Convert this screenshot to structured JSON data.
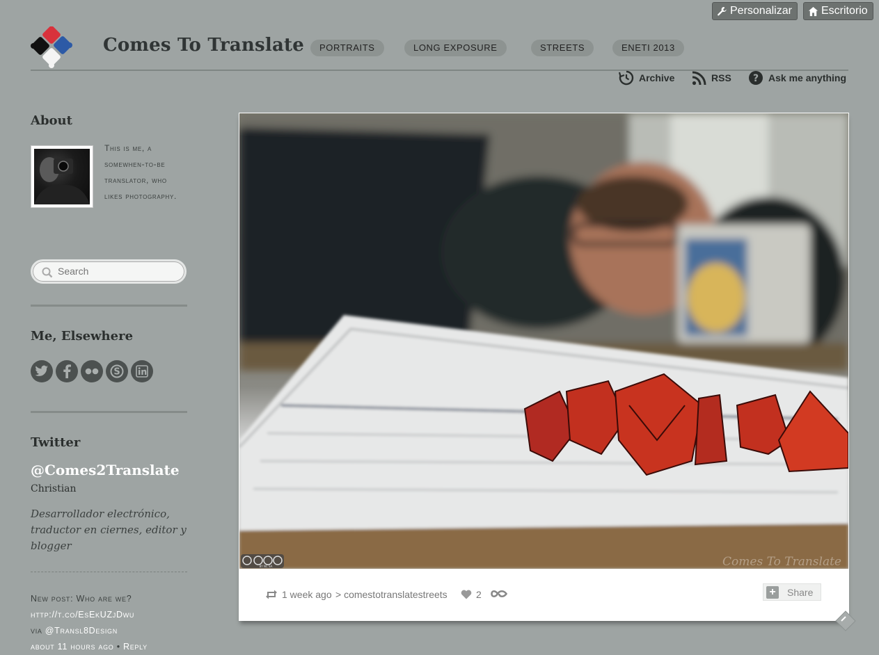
{
  "controls": {
    "customize_label": "Personalizar",
    "dashboard_label": "Escritorio"
  },
  "site": {
    "title": "Comes To Translate"
  },
  "nav": {
    "items": [
      {
        "label": "PORTRAITS"
      },
      {
        "label": "LONG EXPOSURE"
      },
      {
        "label": "STREETS"
      },
      {
        "label": "ENETI 2013"
      }
    ]
  },
  "meta_links": {
    "archive": "Archive",
    "rss": "RSS",
    "ask": "Ask me anything"
  },
  "sidebar": {
    "about_heading": "About",
    "about_text": "This is me, a somewhen-to-be translator, who likes photography.",
    "search_placeholder": "Search",
    "elsewhere_heading": "Me, Elsewhere",
    "social_icons": [
      "twitter-icon",
      "facebook-icon",
      "flickr-icon",
      "skype-icon",
      "linkedin-icon"
    ],
    "twitter_heading": "Twitter",
    "twitter_handle": "@Comes2Translate",
    "twitter_name": "Christian",
    "twitter_bio": "Desarrollador electrónico, traductor en ciernes, editor y blogger",
    "tweet": {
      "text": "New post: Who are we?",
      "link": "http://t.co/EsEkUZjDwu",
      "via_label": "via",
      "via_user": "@Transl8Design",
      "time": "about 11 hours ago",
      "separator": "•",
      "reply": "Reply"
    }
  },
  "post": {
    "watermark": "Comes To Translate",
    "license": "BY NC SA",
    "time_ago": "1 week ago",
    "source": "> comestotranslatestreets",
    "likes": "2",
    "share_label": "Share"
  },
  "colors": {
    "background": "#9ea4a3",
    "accent_red": "#d8323c",
    "accent_blue": "#2d5aa6"
  }
}
